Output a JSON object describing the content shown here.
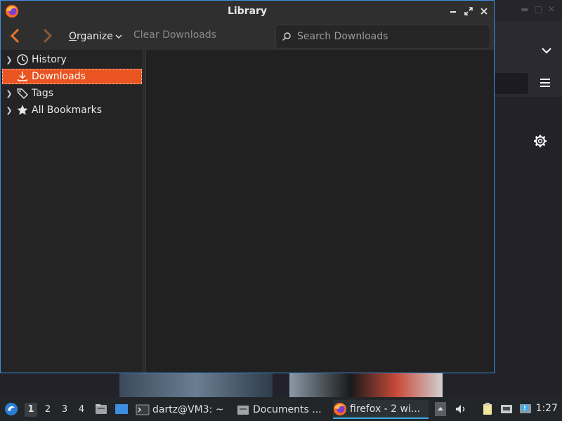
{
  "library": {
    "title": "Library",
    "toolbar": {
      "organize_label": "Organize",
      "clear_downloads_label": "Clear Downloads",
      "search_placeholder": "Search Downloads"
    },
    "sidebar": {
      "items": [
        {
          "label": "History",
          "icon": "clock-icon",
          "expandable": true,
          "selected": false
        },
        {
          "label": "Downloads",
          "icon": "download-icon",
          "expandable": false,
          "selected": true
        },
        {
          "label": "Tags",
          "icon": "tag-icon",
          "expandable": true,
          "selected": false
        },
        {
          "label": "All Bookmarks",
          "icon": "star-icon",
          "expandable": true,
          "selected": false
        }
      ]
    }
  },
  "taskbar": {
    "workspaces": [
      "1",
      "2",
      "3",
      "4"
    ],
    "active_workspace": "1",
    "tasks": [
      {
        "label": "dartz@VM3: ~",
        "icon": "terminal-icon"
      },
      {
        "label": "Documents ...",
        "icon": "folder-icon"
      },
      {
        "label": "firefox - 2 wi...",
        "icon": "firefox-icon"
      }
    ],
    "clock": "1:27"
  },
  "colors": {
    "accent_selected": "#e95420",
    "window_border": "#3d8ee0",
    "taskbar_active": "#3daee9"
  }
}
